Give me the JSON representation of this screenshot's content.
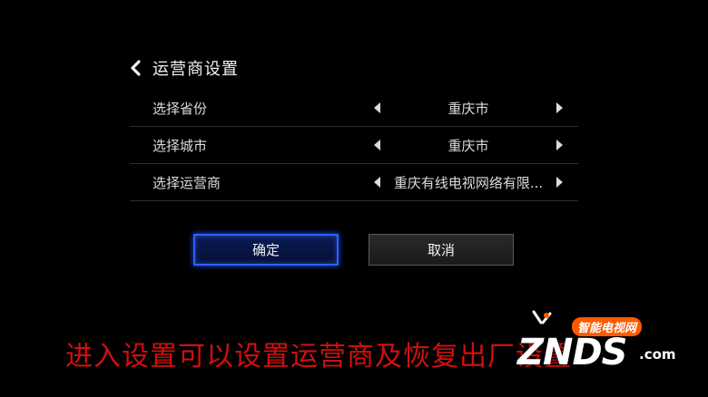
{
  "header": {
    "title": "运营商设置",
    "back_icon": "chevron-left-icon"
  },
  "settings": [
    {
      "label": "选择省份",
      "value": "重庆市"
    },
    {
      "label": "选择城市",
      "value": "重庆市"
    },
    {
      "label": "选择运营商",
      "value": "重庆有线电视网络有限..."
    }
  ],
  "buttons": {
    "confirm": "确定",
    "cancel": "取消"
  },
  "caption": "进入设置可以设置运营商及恢复出厂设置",
  "watermark": {
    "brand": "ZNDS",
    "sub": "智能电视网",
    "suffix": ".com"
  },
  "colors": {
    "accent": "#2a62ff",
    "caption": "#d10f0f",
    "background": "#000000"
  }
}
